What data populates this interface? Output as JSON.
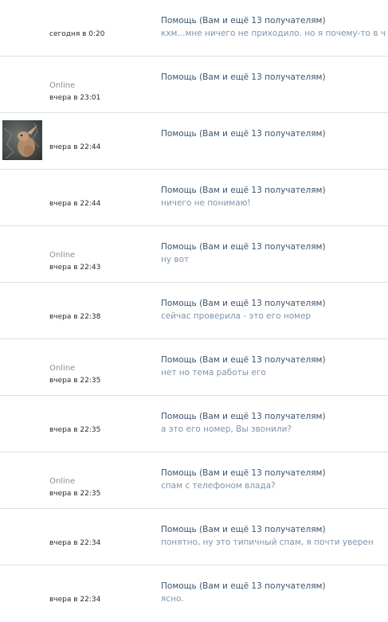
{
  "messages": [
    {
      "status": "",
      "date": "сегодня в 0:20",
      "subject": "Помощь (Вам и ещё 13 получателям)",
      "preview": "кхм...мне ничего не приходило. но я почему-то в чате...",
      "avatar": ""
    },
    {
      "status": "Online",
      "date": "вчера в 23:01",
      "subject": "Помощь (Вам и ещё 13 получателям)",
      "preview": "",
      "avatar": ""
    },
    {
      "status": "",
      "date": "вчера в 22:44",
      "subject": "Помощь (Вам и ещё 13 получателям)",
      "preview": "",
      "avatar": "photo"
    },
    {
      "status": "",
      "date": "вчера в 22:44",
      "subject": "Помощь (Вам и ещё 13 получателям)",
      "preview": "ничего не понимаю!",
      "avatar": ""
    },
    {
      "status": "Online",
      "date": "вчера в 22:43",
      "subject": "Помощь (Вам и ещё 13 получателям)",
      "preview": "ну вот",
      "avatar": ""
    },
    {
      "status": "",
      "date": "вчера в 22:38",
      "subject": "Помощь (Вам и ещё 13 получателям)",
      "preview": "сейчас проверила - это его номер",
      "avatar": ""
    },
    {
      "status": "Online",
      "date": "вчера в 22:35",
      "subject": "Помощь (Вам и ещё 13 получателям)",
      "preview": "нет но тема работы его",
      "avatar": ""
    },
    {
      "status": "",
      "date": "вчера в 22:35",
      "subject": "Помощь (Вам и ещё 13 получателям)",
      "preview": "а это его номер, Вы звонили?",
      "avatar": ""
    },
    {
      "status": "Online",
      "date": "вчера в 22:35",
      "subject": "Помощь (Вам и ещё 13 получателям)",
      "preview": "спам с телефоном влада?",
      "avatar": ""
    },
    {
      "status": "",
      "date": "вчера в 22:34",
      "subject": "Помощь (Вам и ещё 13 получателям)",
      "preview": "понятно, ну это типичный спам, я почти уверен",
      "avatar": ""
    },
    {
      "status": "",
      "date": "вчера в 22:34",
      "subject": "Помощь (Вам и ещё 13 получателям)",
      "preview": "ясно.",
      "avatar": ""
    }
  ]
}
